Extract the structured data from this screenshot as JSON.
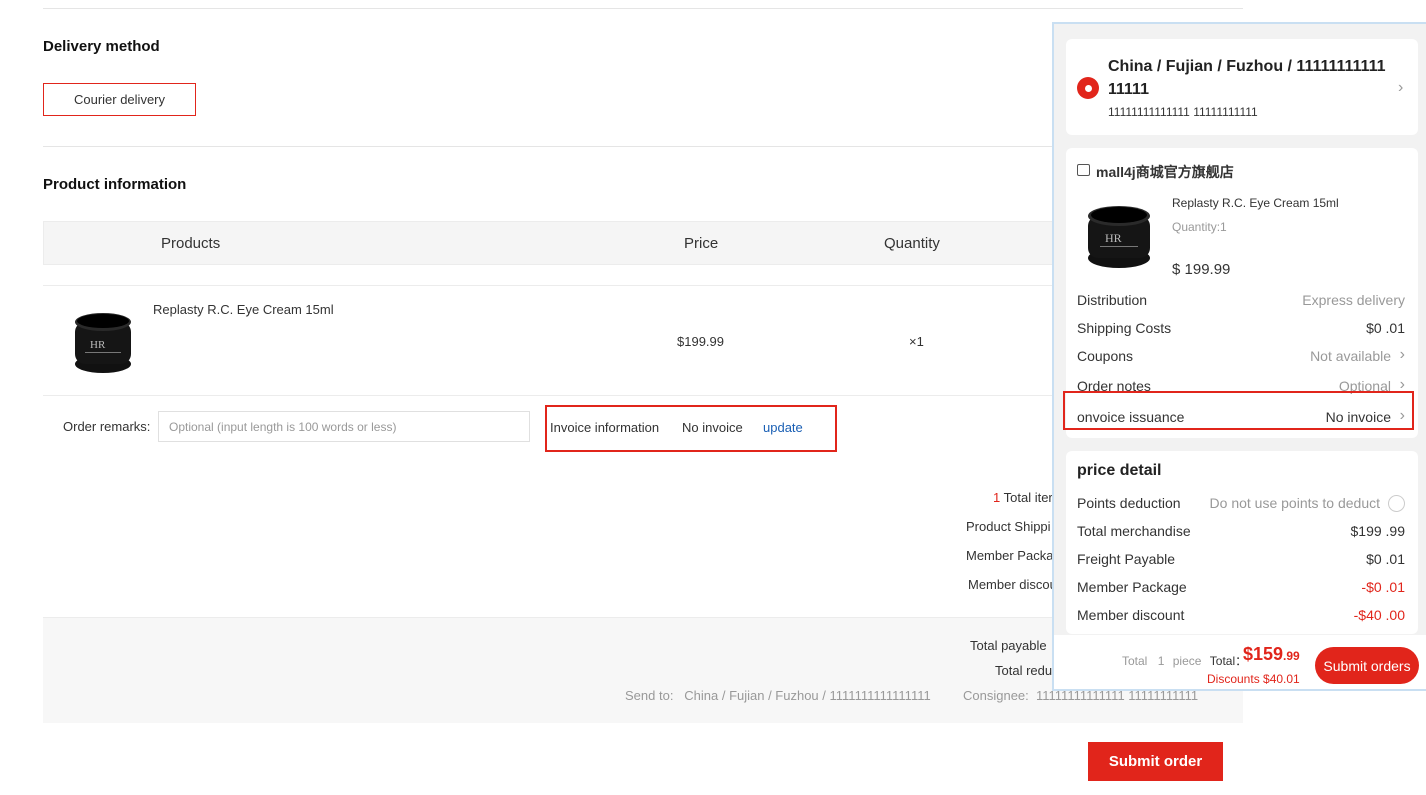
{
  "delivery": {
    "title": "Delivery method",
    "option": "Courier delivery"
  },
  "product_info": {
    "title": "Product information",
    "columns": [
      "Products",
      "Price",
      "Quantity"
    ],
    "items": [
      {
        "name": "Replasty R.C. Eye Cream 15ml",
        "price": "$199.99",
        "quantity": "×1"
      }
    ]
  },
  "remarks": {
    "label": "Order remarks:",
    "placeholder": "Optional (input length is 100 words or less)"
  },
  "invoice": {
    "label": "Invoice information",
    "value": "No invoice",
    "action": "update"
  },
  "summary": {
    "total_items_count": "1",
    "total_items_label": "Total iter",
    "shipping_label": "Product Shippi",
    "member_package_label": "Member Packa",
    "member_discount_label": "Member discou"
  },
  "totals": {
    "payable_label": "Total payable",
    "reduction_label": "Total redu",
    "send_to": "Send to:   China / Fujian / Fuzhou / 1111111111111111",
    "consignee": "Consignee:  11111111111111 11111111111"
  },
  "submit_label": "Submit order",
  "mobile": {
    "address": {
      "line1": "China / Fujian / Fuzhou / 11111111111 11111",
      "line2": "11111111111111 11111111111"
    },
    "store": "mall4j商城官方旗舰店",
    "product": {
      "name": "Replasty R.C. Eye Cream 15ml",
      "quantity": "Quantity:1",
      "price": "$ 199.99"
    },
    "rows": [
      {
        "label": "Distribution",
        "value": "Express delivery"
      },
      {
        "label": "Shipping Costs",
        "value": "$0 .01"
      },
      {
        "label": "Coupons",
        "value": "Not available"
      },
      {
        "label": "Order notes",
        "value": "Optional"
      },
      {
        "label": "onvoice issuance",
        "value": "No invoice"
      }
    ],
    "price_detail": {
      "title": "price detail",
      "points_label": "Points deduction",
      "points_value": "Do not use points to deduct",
      "lines": [
        {
          "label": "Total merchandise",
          "value": "$199 .99"
        },
        {
          "label": "Freight Payable",
          "value": "$0 .01"
        },
        {
          "label": "Member Package",
          "value": "-$0 .01"
        },
        {
          "label": "Member discount",
          "value": "-$40 .00"
        }
      ]
    },
    "bottom": {
      "total_prefix": "Total",
      "piece_count": "1",
      "piece_label": "piece",
      "total_label": "Total：",
      "total_main": "$159",
      "total_cents": ".99",
      "discounts": "Discounts $40.01",
      "submit": "Submit orders"
    }
  }
}
